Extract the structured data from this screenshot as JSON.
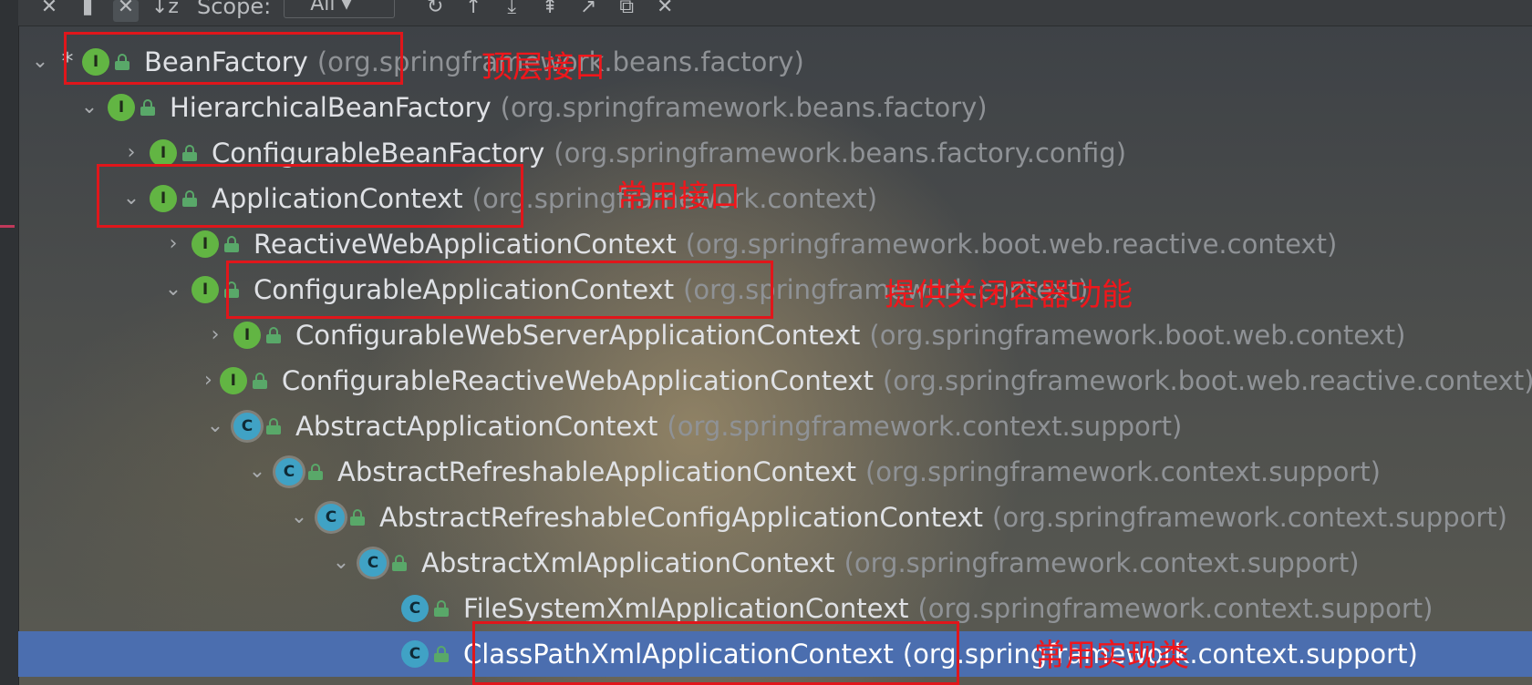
{
  "toolbar": {
    "scope_label": "Scope:",
    "scope_value": "All",
    "buttons": [
      "collapse-icon",
      "pin-icon",
      "expand-icon",
      "sort-alpha-icon",
      "refresh-icon",
      "up-icon",
      "down-icon",
      "export-icon",
      "navigate-icon",
      "open-icon",
      "close-icon"
    ]
  },
  "tree": {
    "rows": [
      {
        "star": "*",
        "chevron": "⌄",
        "kind": "I",
        "name": "BeanFactory",
        "pkg": "(org.springframework.beans.factory)"
      },
      {
        "chevron": "⌄",
        "kind": "I",
        "name": "HierarchicalBeanFactory",
        "pkg": "(org.springframework.beans.factory)"
      },
      {
        "chevron": "›",
        "kind": "I",
        "name": "ConfigurableBeanFactory",
        "pkg": "(org.springframework.beans.factory.config)"
      },
      {
        "chevron": "⌄",
        "kind": "I",
        "name": "ApplicationContext",
        "pkg": "(org.springframework.context)"
      },
      {
        "chevron": "›",
        "kind": "I",
        "name": "ReactiveWebApplicationContext",
        "pkg": "(org.springframework.boot.web.reactive.context)"
      },
      {
        "chevron": "⌄",
        "kind": "I",
        "name": "ConfigurableApplicationContext",
        "pkg": "(org.springframework.context)"
      },
      {
        "chevron": "›",
        "kind": "I",
        "name": "ConfigurableWebServerApplicationContext",
        "pkg": "(org.springframework.boot.web.context)"
      },
      {
        "chevron": "›",
        "kind": "I",
        "name": "ConfigurableReactiveWebApplicationContext",
        "pkg": "(org.springframework.boot.web.reactive.context)"
      },
      {
        "chevron": "⌄",
        "kind": "C",
        "name": "AbstractApplicationContext",
        "pkg": "(org.springframework.context.support)"
      },
      {
        "chevron": "⌄",
        "kind": "C",
        "name": "AbstractRefreshableApplicationContext",
        "pkg": "(org.springframework.context.support)"
      },
      {
        "chevron": "⌄",
        "kind": "C",
        "name": "AbstractRefreshableConfigApplicationContext",
        "pkg": "(org.springframework.context.support)"
      },
      {
        "chevron": "⌄",
        "kind": "C",
        "name": "AbstractXmlApplicationContext",
        "pkg": "(org.springframework.context.support)"
      },
      {
        "chevron": "",
        "kind": "C",
        "name": "FileSystemXmlApplicationContext",
        "pkg": "(org.springframework.context.support)"
      },
      {
        "chevron": "",
        "kind": "C",
        "name": "ClassPathXmlApplicationContext",
        "pkg": "(org.springframework.context.support)"
      }
    ]
  },
  "annotations": {
    "top_interface": "顶层接口",
    "common_interface": "常用接口",
    "close_container": "提供关闭容器功能",
    "common_impl": "常用实现类"
  },
  "colors": {
    "annotation_red": "#e0161b",
    "selection_blue": "#4b6eaf",
    "interface_green": "#62b543",
    "class_blue": "#40a2c5"
  }
}
